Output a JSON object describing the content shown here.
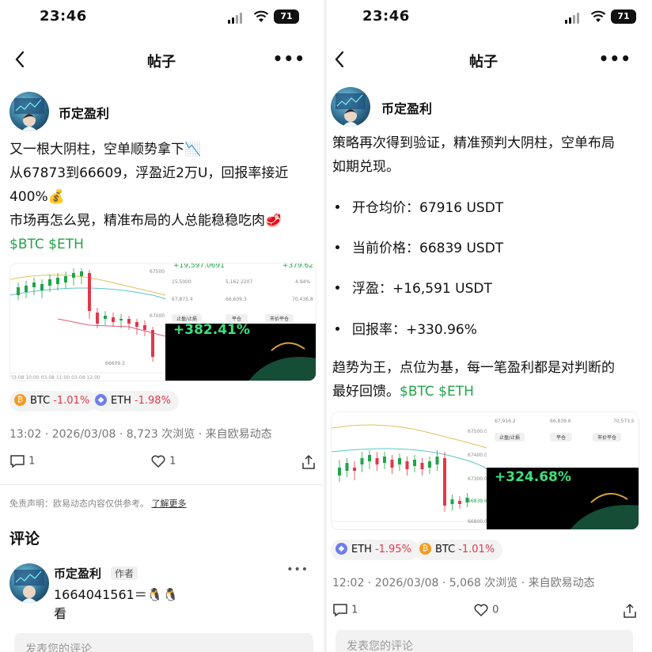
{
  "status": {
    "time": "23:46",
    "battery": "71"
  },
  "left": {
    "nav": {
      "title": "帖子"
    },
    "author": {
      "name": "币定盈利"
    },
    "post_lines": [
      "又一根大阴柱，空单顺势拿下📉",
      "从67873到66609，浮盈近2万U，回报率接近",
      "400%💰",
      "市场再怎么晃，精准布局的人总能稳稳吃肉🥩"
    ],
    "tags": "$BTC $ETH",
    "image": {
      "pnl_top": "+19,597.0691",
      "pnl_top_pct": "+379.62%",
      "pnl_big": "+382.41%",
      "rows": [
        [
          "15.5000",
          "5,162.2207",
          "4.94%"
        ],
        [
          "67,873.4",
          "66,609.3",
          "70,436.8"
        ]
      ],
      "buttons": [
        "止盈/止损",
        "平仓",
        "市价平仓"
      ],
      "prices": [
        "67500.0",
        "67000.0",
        "66609.3"
      ],
      "dates": [
        "03-08 10:00",
        "03-08 11:00",
        "03-08 12:00"
      ]
    },
    "chips": [
      {
        "icon": "btc-icon",
        "symbol": "BTC",
        "change": "-1.01%",
        "color": "#f39a1e"
      },
      {
        "icon": "eth-icon",
        "symbol": "ETH",
        "change": "-1.98%",
        "color": "#6a7ef0"
      }
    ],
    "meta": "13:02 · 2026/03/08 · 8,723 次浏览 · 来自欧易动态",
    "comments_count": "1",
    "likes_count": "1",
    "disclaimer": "免责声明：欧易动态内容仅供参考。",
    "disclaimer_link": "了解更多",
    "comments_title": "评论",
    "comment": {
      "author": "币定盈利",
      "badge": "作者",
      "text1": "1664041561＝🐧🐧",
      "text2": "看"
    },
    "comment_placeholder": "发表您的评论"
  },
  "right": {
    "nav": {
      "title": "帖子"
    },
    "author": {
      "name": "币定盈利"
    },
    "intro_lines": [
      "策略再次得到验证，精准预判大阴柱，空单布局",
      "如期兑现。"
    ],
    "bullets": [
      "开仓均价：67916 USDT",
      "当前价格：66839 USDT",
      "浮盈：+16,591 USDT",
      "回报率：+330.96%"
    ],
    "outro_line1": "趋势为王，点位为基，每一笔盈利都是对判断的",
    "outro_line2_prefix": "最好回馈。",
    "tags": "$BTC $ETH",
    "image": {
      "pnl_big": "+324.68%",
      "rows": [
        [
          "67,916.2",
          "66,839.6",
          "70,573.5"
        ]
      ],
      "buttons": [
        "止盈/止损",
        "平仓",
        "市价平仓"
      ],
      "prices": [
        "67500.0",
        "67400.0",
        "67300.0",
        "66839.6",
        "66800.0"
      ]
    },
    "chips": [
      {
        "icon": "eth-icon",
        "symbol": "ETH",
        "change": "-1.95%",
        "color": "#6a7ef0"
      },
      {
        "icon": "btc-icon",
        "symbol": "BTC",
        "change": "-1.01%",
        "color": "#f39a1e"
      }
    ],
    "meta": "12:02 · 2026/03/08 · 5,068 次浏览 · 来自欧易动态",
    "comments_count": "1",
    "likes_count": "0",
    "comment_placeholder": "发表您的评论"
  }
}
